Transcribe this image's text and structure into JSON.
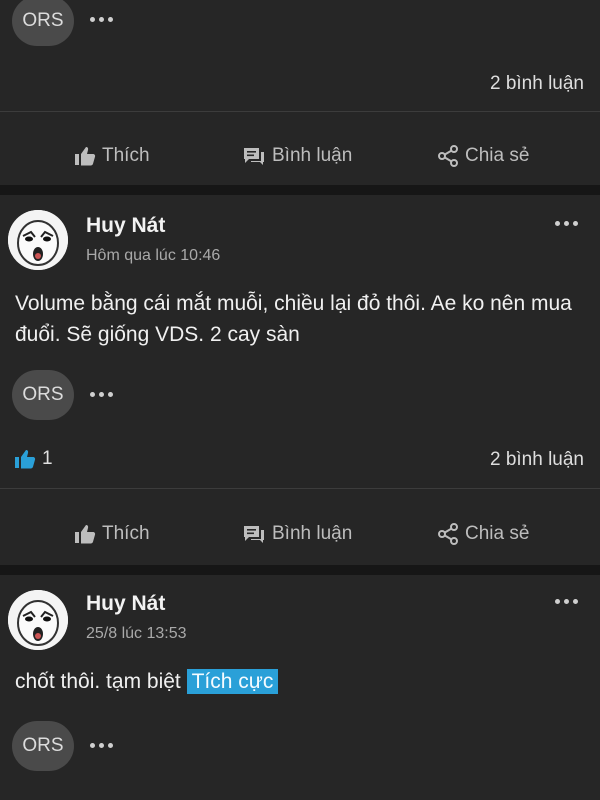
{
  "top_post": {
    "reaction_chip": "ORS",
    "comment_count": "2 bình luận"
  },
  "actions": {
    "like": "Thích",
    "comment": "Bình luận",
    "share": "Chia sẻ"
  },
  "posts": [
    {
      "author": "Huy Nát",
      "time": "Hôm qua lúc 10:46",
      "text": "Volume bằng cái mắt muỗi, chiều lại đỏ thôi. Ae ko nên mua đuổi. Sẽ giống VDS. 2 cay sàn",
      "reaction_chip": "ORS",
      "like_count": "1",
      "comment_count": "2 bình luận"
    },
    {
      "author": "Huy Nát",
      "time": "25/8 lúc 13:53",
      "text": "chốt thôi. tạm biệt",
      "tag": "Tích cực",
      "reaction_chip": "ORS"
    }
  ],
  "colors": {
    "card_bg": "#262626",
    "page_bg": "#161616",
    "accent": "#2aa0d8"
  }
}
